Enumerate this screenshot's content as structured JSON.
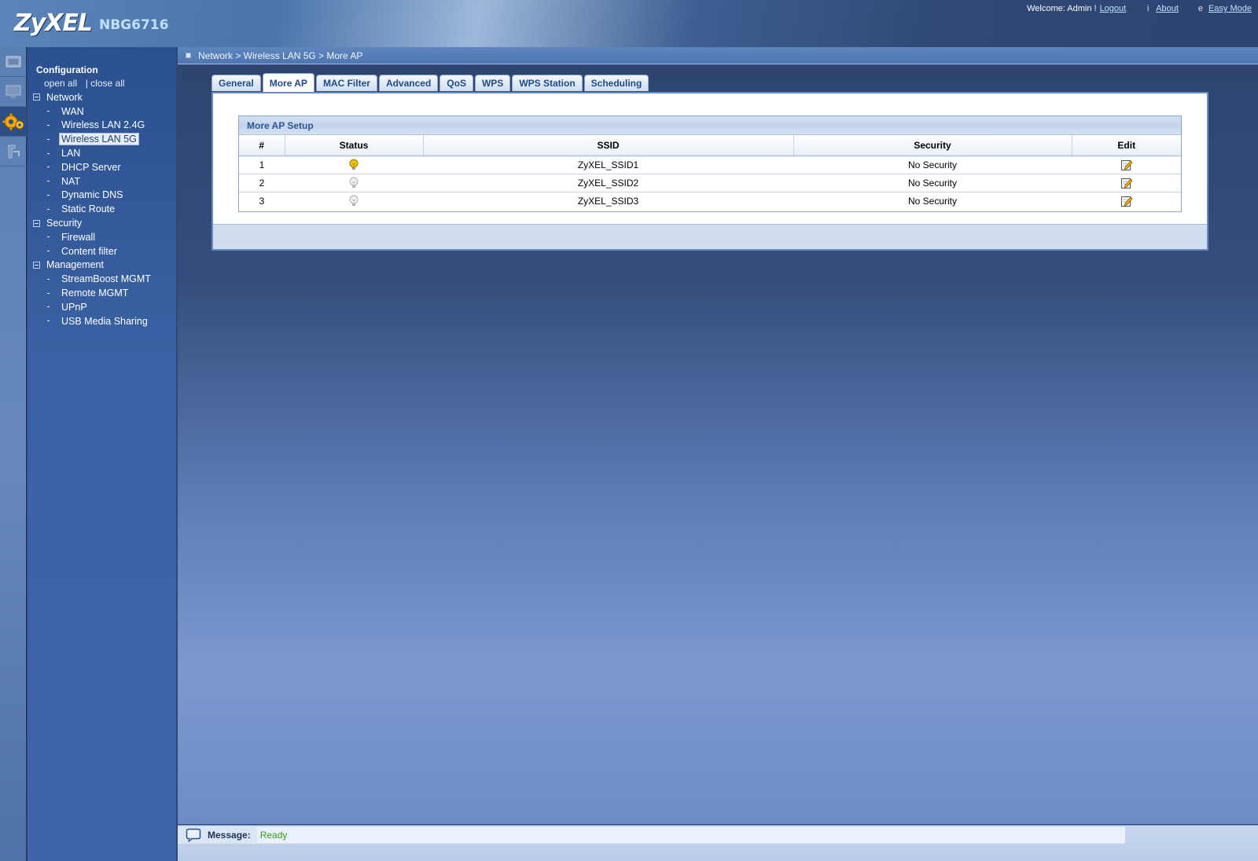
{
  "header": {
    "brand": "ZyXEL",
    "model": "NBG6716",
    "welcome": "Welcome: Admin !",
    "logout": "Logout",
    "about": "About",
    "easy_mode": "Easy Mode"
  },
  "sidebar": {
    "title": "Configuration",
    "open_all": "open all",
    "close_all": "| close all",
    "groups": [
      {
        "label": "Network",
        "items": [
          "WAN",
          "Wireless LAN 2.4G",
          "Wireless LAN 5G",
          "LAN",
          "DHCP Server",
          "NAT",
          "Dynamic DNS",
          "Static Route"
        ]
      },
      {
        "label": "Security",
        "items": [
          "Firewall",
          "Content filter"
        ]
      },
      {
        "label": "Management",
        "items": [
          "StreamBoost MGMT",
          "Remote MGMT",
          "UPnP",
          "USB Media Sharing"
        ]
      }
    ],
    "selected": "Wireless LAN 5G"
  },
  "breadcrumb": "Network > Wireless LAN 5G > More AP",
  "tabs": [
    "General",
    "More AP",
    "MAC Filter",
    "Advanced",
    "QoS",
    "WPS",
    "WPS Station",
    "Scheduling"
  ],
  "active_tab": "More AP",
  "section": {
    "title": "More AP Setup",
    "columns": [
      "#",
      "Status",
      "SSID",
      "Security",
      "Edit"
    ],
    "rows": [
      {
        "num": "1",
        "status": "on",
        "ssid": "ZyXEL_SSID1",
        "security": "No Security"
      },
      {
        "num": "2",
        "status": "off",
        "ssid": "ZyXEL_SSID2",
        "security": "No Security"
      },
      {
        "num": "3",
        "status": "off",
        "ssid": "ZyXEL_SSID3",
        "security": "No Security"
      }
    ]
  },
  "status_bar": {
    "label": "Message:",
    "value": "Ready"
  },
  "colors": {
    "bulb_on": "#f2c200",
    "bulb_off": "#c8c8c8",
    "accent": "#1d4a8c",
    "status_ready": "#3a9a1e"
  }
}
